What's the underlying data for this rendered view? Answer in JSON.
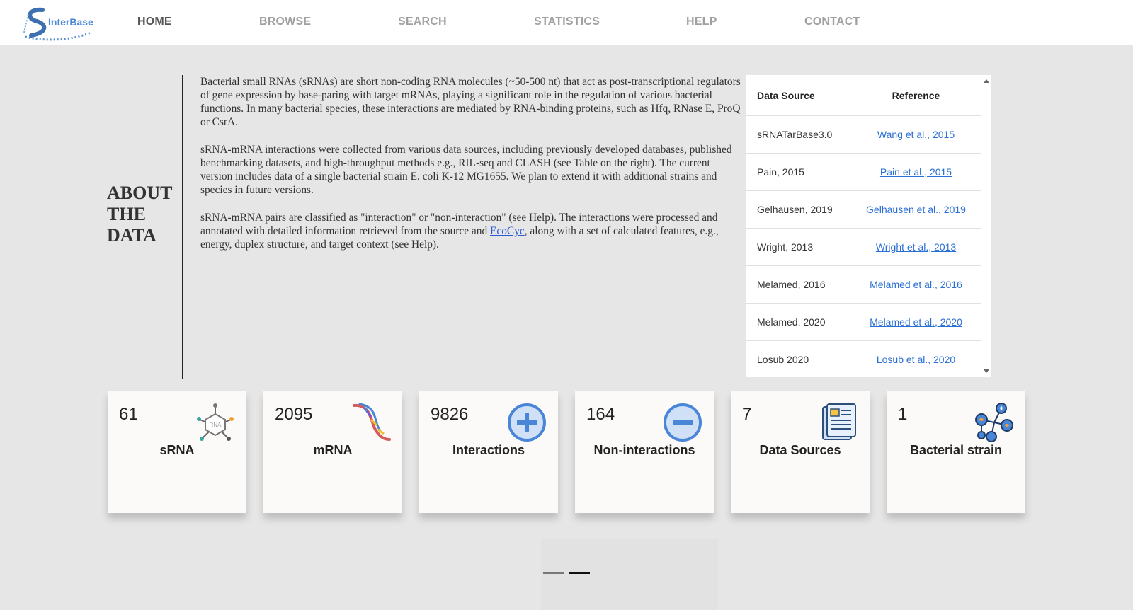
{
  "nav": {
    "logo_text": "InterBase",
    "links": [
      "HOME",
      "BROWSE",
      "SEARCH",
      "STATISTICS",
      "HELP",
      "CONTACT"
    ]
  },
  "about": {
    "title_lines": [
      "ABOUT",
      "THE",
      "DATA"
    ],
    "p1": "Bacterial small RNAs (sRNAs) are short non-coding RNA molecules (~50-500 nt) that act as post-transcriptional regulators of gene expression by base-paring with target mRNAs, playing a significant role in the regulation of various bacterial functions. In many bacterial species, these interactions are mediated by RNA-binding proteins, such as Hfq, RNase E, ProQ or CsrA.",
    "p2": "sRNA-mRNA interactions were collected from various data sources, including previously developed databases, published benchmarking datasets, and high-throughput methods e.g., RIL-seq and CLASH (see Table on the right). The current version includes data of a single bacterial strain E. coli K-12 MG1655. We plan to extend it with additional strains and species in future versions.",
    "p3_before": "sRNA-mRNA pairs are classified as \"interaction\" or \"non-interaction\" (see Help). The interactions were processed and annotated with detailed information retrieved from the source and ",
    "p3_link": "EcoCyc",
    "p3_after": ", along with a set of calculated features, e.g., energy, duplex structure, and target context (see Help)."
  },
  "sources_table": {
    "headers": [
      "Data Source",
      "Reference"
    ],
    "rows": [
      {
        "source": "sRNATarBase3.0",
        "reference": "Wang et al., 2015"
      },
      {
        "source": "Pain, 2015",
        "reference": "Pain et al., 2015"
      },
      {
        "source": "Gelhausen, 2019",
        "reference": "Gelhausen et al., 2019"
      },
      {
        "source": "Wright, 2013",
        "reference": "Wright et al., 2013"
      },
      {
        "source": "Melamed, 2016",
        "reference": "Melamed et al., 2016"
      },
      {
        "source": "Melamed, 2020",
        "reference": "Melamed et al., 2020"
      },
      {
        "source": "Losub 2020",
        "reference": "Losub et al., 2020"
      }
    ]
  },
  "stats": [
    {
      "value": "61",
      "label": "sRNA",
      "icon": "rna-molecule-icon"
    },
    {
      "value": "2095",
      "label": "mRNA",
      "icon": "dna-helix-icon"
    },
    {
      "value": "9826",
      "label": "Interactions",
      "icon": "plus-circle-icon"
    },
    {
      "value": "164",
      "label": "Non-interactions",
      "icon": "minus-circle-icon"
    },
    {
      "value": "7",
      "label": "Data Sources",
      "icon": "document-icon"
    },
    {
      "value": "1",
      "label": "Bacterial strain",
      "icon": "bacteria-network-icon"
    }
  ],
  "pager": {
    "pages": 2,
    "active_index": 1
  },
  "colors": {
    "link": "#2a6fd6",
    "accent_blue": "#4a86d8",
    "nav_active": "#555555",
    "nav_inactive": "#a0a0a0"
  }
}
